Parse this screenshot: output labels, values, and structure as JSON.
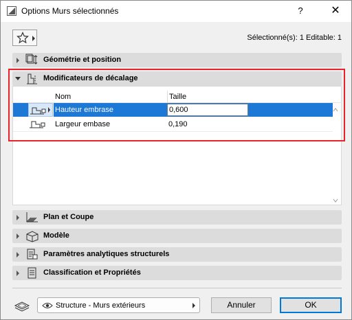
{
  "window": {
    "title": "Options Murs sélectionnés",
    "help_label": "?",
    "close_label": "✕"
  },
  "selection_info": "Sélectionné(s): 1 Editable: 1",
  "sections": {
    "geometry": "Géométrie et position",
    "offsets": "Modificateurs de décalage",
    "plan": "Plan et Coupe",
    "model": "Modèle",
    "analytic": "Paramètres analytiques structurels",
    "classification": "Classification et Propriétés"
  },
  "table": {
    "headers": [
      "Nom",
      "Taille"
    ],
    "rows": [
      {
        "name": "Hauteur embrase",
        "value": "0,600",
        "selected": true
      },
      {
        "name": "Largeur embase",
        "value": "0,190",
        "selected": false
      }
    ]
  },
  "footer": {
    "layer": "Structure - Murs extérieurs",
    "cancel_label": "Annuler",
    "ok_label": "OK"
  },
  "colors": {
    "selection": "#1e78d6",
    "highlight_frame": "#e8212b",
    "section_bg": "#dcdcdc"
  },
  "icons": [
    "app-icon",
    "star-icon",
    "geometry-icon",
    "offset-icon",
    "wall-profile-icon",
    "plan-section-icon",
    "model-icon",
    "analytic-icon",
    "classification-icon",
    "layer-icon",
    "eye-icon"
  ]
}
